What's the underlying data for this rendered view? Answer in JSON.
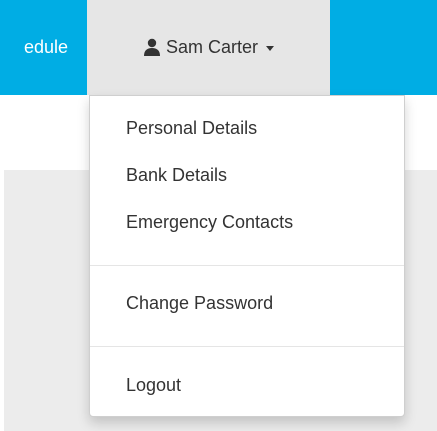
{
  "navbar": {
    "accent_color": "#00ade4",
    "schedule_link": "edule",
    "user_menu": {
      "icon": "user-icon",
      "label": "Sam Carter",
      "caret_icon": "caret-down-icon"
    }
  },
  "dropdown": {
    "items": [
      {
        "label": "Personal Details"
      },
      {
        "label": "Bank Details"
      },
      {
        "label": "Emergency Contacts"
      },
      {
        "label": "Change Password"
      },
      {
        "label": "Logout"
      }
    ]
  }
}
